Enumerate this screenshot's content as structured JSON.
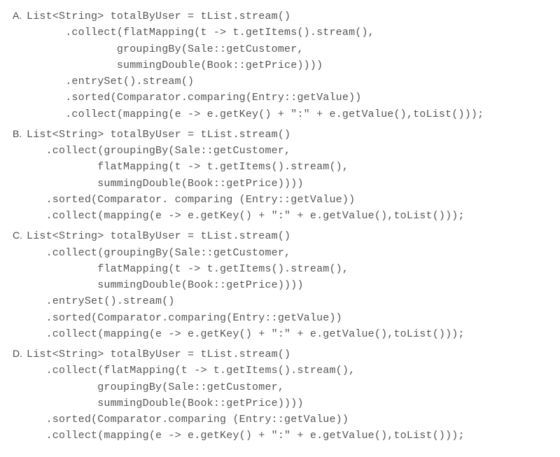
{
  "options": [
    {
      "label": "A.",
      "lines": [
        "List<String> totalByUser = tList.stream()",
        "      .collect(flatMapping(t -> t.getItems().stream(),",
        "              groupingBy(Sale::getCustomer,",
        "              summingDouble(Book::getPrice))))",
        "      .entrySet().stream()",
        "      .sorted(Comparator.comparing(Entry::getValue))",
        "      .collect(mapping(e -> e.getKey() + \":\" + e.getValue(),toList()));"
      ]
    },
    {
      "label": "B.",
      "lines": [
        "List<String> totalByUser = tList.stream()",
        "   .collect(groupingBy(Sale::getCustomer,",
        "           flatMapping(t -> t.getItems().stream(),",
        "           summingDouble(Book::getPrice))))",
        "   .sorted(Comparator. comparing (Entry::getValue))",
        "   .collect(mapping(e -> e.getKey() + \":\" + e.getValue(),toList()));"
      ]
    },
    {
      "label": "C.",
      "lines": [
        "List<String> totalByUser = tList.stream()",
        "   .collect(groupingBy(Sale::getCustomer,",
        "           flatMapping(t -> t.getItems().stream(),",
        "           summingDouble(Book::getPrice))))",
        "   .entrySet().stream()",
        "   .sorted(Comparator.comparing(Entry::getValue))",
        "   .collect(mapping(e -> e.getKey() + \":\" + e.getValue(),toList()));"
      ]
    },
    {
      "label": "D.",
      "lines": [
        "List<String> totalByUser = tList.stream()",
        "   .collect(flatMapping(t -> t.getItems().stream(),",
        "           groupingBy(Sale::getCustomer,",
        "           summingDouble(Book::getPrice))))",
        "   .sorted(Comparator.comparing (Entry::getValue))",
        "   .collect(mapping(e -> e.getKey() + \":\" + e.getValue(),toList()));"
      ]
    }
  ]
}
